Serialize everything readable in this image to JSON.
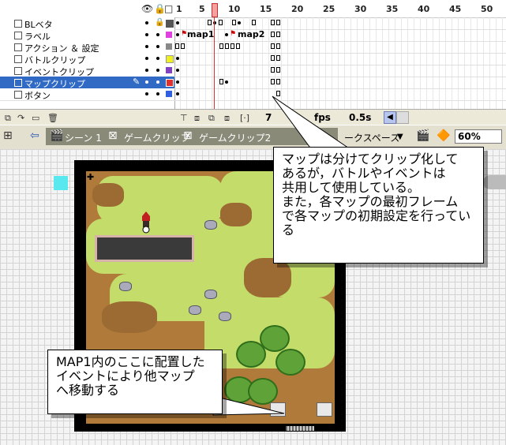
{
  "timeline": {
    "ruler_numbers": [
      "1",
      "5",
      "10",
      "15",
      "20",
      "25",
      "30",
      "35",
      "40",
      "45",
      "50"
    ],
    "layers": [
      {
        "name": "BLベタ",
        "swatch": "#555555"
      },
      {
        "name": "ラベル",
        "swatch": "#e040e0"
      },
      {
        "name": "アクション ＆ 設定",
        "swatch": "#888888"
      },
      {
        "name": "バトルクリップ",
        "swatch": "#f0f020"
      },
      {
        "name": "イベントクリップ",
        "swatch": "#8040c0"
      },
      {
        "name": "マップクリップ",
        "swatch": "#e03030",
        "selected": true
      },
      {
        "name": "ボタン",
        "swatch": "#3060e0"
      }
    ],
    "frame_labels": {
      "map1": "map1",
      "map2": "map2"
    },
    "status": {
      "frame": "7",
      "fps_text": "fps",
      "time": "0.5s"
    }
  },
  "nav": {
    "scene": "シーン 1",
    "crumb1": "ゲームクリップ",
    "crumb2": "ゲームクリップ2",
    "workspace": "ークスペース",
    "zoom": "60%"
  },
  "callouts": {
    "top": [
      "マップは分けてクリップ化して",
      "あるが，バトルやイベントは",
      "共用して使用している。",
      "また，各マップの最初フレーム",
      "で各マップの初期設定を行ってい",
      "る"
    ],
    "bottom": [
      "MAP1内のここに配置した",
      "イベントにより他マップ",
      "へ移動する"
    ]
  },
  "colors": {
    "selection": "#316ac5",
    "playhead": "#f7a0a0"
  }
}
